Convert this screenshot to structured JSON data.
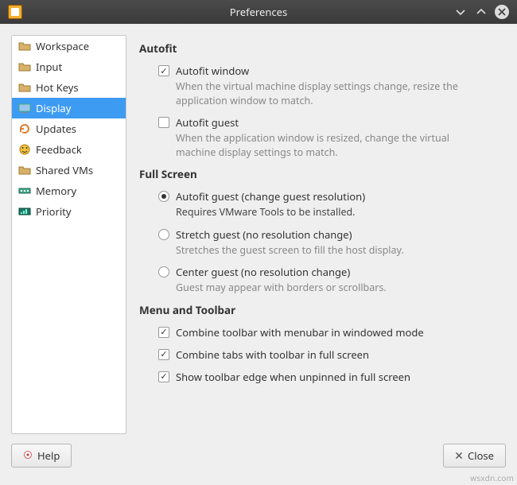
{
  "window": {
    "title": "Preferences"
  },
  "sidebar": {
    "items": [
      {
        "icon": "folder-icon",
        "label": "Workspace"
      },
      {
        "icon": "folder-icon",
        "label": "Input"
      },
      {
        "icon": "folder-icon",
        "label": "Hot Keys"
      },
      {
        "icon": "monitor-icon",
        "label": "Display"
      },
      {
        "icon": "refresh-icon",
        "label": "Updates"
      },
      {
        "icon": "smiley-icon",
        "label": "Feedback"
      },
      {
        "icon": "folder-icon",
        "label": "Shared VMs"
      },
      {
        "icon": "memory-icon",
        "label": "Memory"
      },
      {
        "icon": "priority-icon",
        "label": "Priority"
      }
    ],
    "selected_index": 3
  },
  "sections": {
    "autofit": {
      "title": "Autofit",
      "autofit_window": {
        "label": "Autofit window",
        "desc": "When the virtual machine display settings change, resize the application window to match.",
        "checked": true
      },
      "autofit_guest": {
        "label": "Autofit guest",
        "desc": "When the application window is resized, change the virtual machine display settings to match.",
        "checked": false
      }
    },
    "fullscreen": {
      "title": "Full Screen",
      "selected": "autofit",
      "autofit": {
        "label": "Autofit guest (change guest resolution)",
        "desc": "Requires VMware Tools to be installed."
      },
      "stretch": {
        "label": "Stretch guest (no resolution change)",
        "desc": "Stretches the guest screen to fill the host display."
      },
      "center": {
        "label": "Center guest (no resolution change)",
        "desc": "Guest may appear with borders or scrollbars."
      }
    },
    "menu": {
      "title": "Menu and Toolbar",
      "combine_toolbar": {
        "label": "Combine toolbar with menubar in windowed mode",
        "checked": true
      },
      "combine_tabs": {
        "label": "Combine tabs with toolbar in full screen",
        "checked": true
      },
      "show_edge": {
        "label": "Show toolbar edge when unpinned in full screen",
        "checked": true
      }
    }
  },
  "buttons": {
    "help": "Help",
    "close": "Close"
  },
  "watermark": "wsxdn.com"
}
